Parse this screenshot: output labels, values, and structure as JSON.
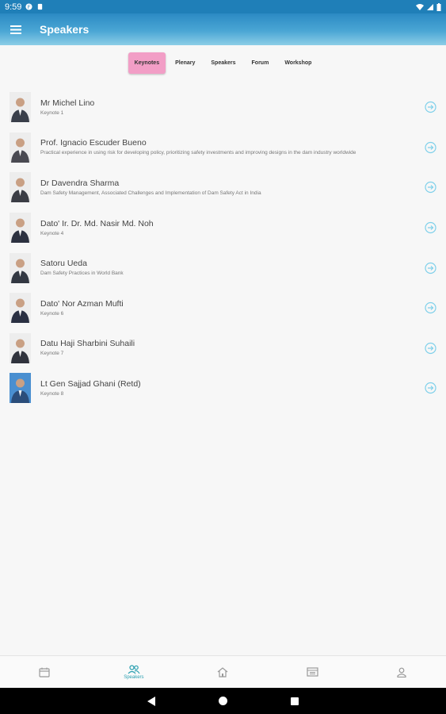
{
  "status_bar": {
    "time": "9:59"
  },
  "app_bar": {
    "title": "Speakers",
    "menu_icon": "menu-icon"
  },
  "tabs": [
    {
      "label": "Keynotes",
      "active": true
    },
    {
      "label": "Plenary",
      "active": false
    },
    {
      "label": "Speakers",
      "active": false
    },
    {
      "label": "Forum",
      "active": false
    },
    {
      "label": "Workshop",
      "active": false
    }
  ],
  "speakers": [
    {
      "name": "Mr Michel Lino",
      "subtitle": "Keynote 1"
    },
    {
      "name": "Prof. Ignacio Escuder Bueno",
      "subtitle": "Practical experience in using risk for developing policy, prioritizing safety investments and improving designs in the dam industry worldwide"
    },
    {
      "name": "Dr Davendra Sharma",
      "subtitle": "Dam Safety Management, Associated Challenges and Implementation of Dam Safety Act in India"
    },
    {
      "name": "Dato' Ir. Dr. Md. Nasir Md. Noh",
      "subtitle": "Keynote 4"
    },
    {
      "name": "Satoru Ueda",
      "subtitle": "Dam Safety Practices in World Bank"
    },
    {
      "name": "Dato' Nor Azman Mufti",
      "subtitle": "Keynote 6"
    },
    {
      "name": "Datu Haji Sharbini Suhaili",
      "subtitle": "Keynote 7"
    },
    {
      "name": "Lt Gen Sajjad Ghani (Retd)",
      "subtitle": "Keynote 8"
    }
  ],
  "bottom_nav": [
    {
      "icon": "calendar-icon",
      "label": ""
    },
    {
      "icon": "people-icon",
      "label": "Speakers",
      "active": true
    },
    {
      "icon": "home-icon",
      "label": ""
    },
    {
      "icon": "schedule-icon",
      "label": ""
    },
    {
      "icon": "person-icon",
      "label": ""
    }
  ],
  "colors": {
    "accent": "#2a9fb0",
    "tab_active": "#f29ec6",
    "app_bar": "#2b8ac4"
  }
}
